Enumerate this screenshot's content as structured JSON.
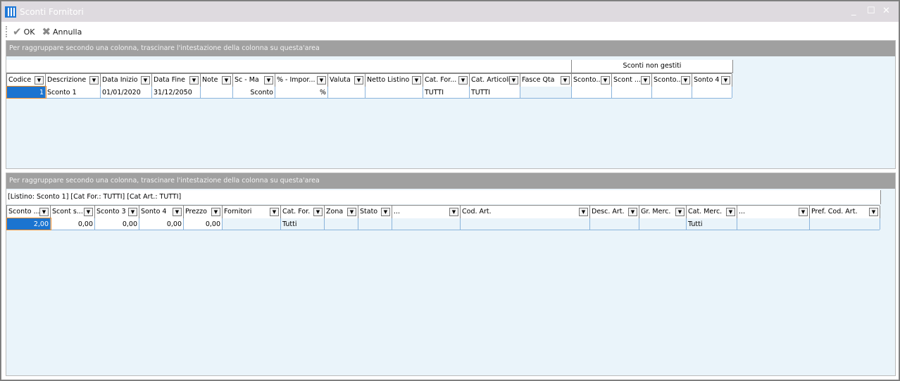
{
  "window": {
    "title": "Sconti Fornitori",
    "minimize": "_",
    "maximize": "☐",
    "close": "✕"
  },
  "toolbar": {
    "ok_label": "OK",
    "cancel_label": "Annulla"
  },
  "top_grid": {
    "group_hint": "Per raggruppare secondo una colonna, trascinare l'intestazione della colonna su questa'area",
    "band_label": "Sconti non gestiti",
    "columns": [
      "Codice",
      "Descrizione",
      "Data Inizio",
      "Data Fine",
      "Note",
      "Sc - Ma",
      "% - Impor...",
      "Valuta",
      "Netto Listino",
      "Cat. For...",
      "Cat. Articoli",
      "Fasce Qta",
      "Sconto...",
      "Scont ...",
      "Sconto...",
      "Sonto 4"
    ],
    "rows": [
      [
        "1",
        "Sconto 1",
        "01/01/2020",
        "31/12/2050",
        "",
        "Sconto",
        "%",
        "",
        "",
        "TUTTI",
        "TUTTI",
        "",
        "",
        "",
        "",
        ""
      ]
    ]
  },
  "bottom_grid": {
    "group_hint": "Per raggruppare secondo una colonna, trascinare l'intestazione della colonna su questa'area",
    "filter_text": "[Listino: Sconto 1]  [Cat For.: TUTTI]  [Cat Art.: TUTTI]",
    "columns": [
      "Sconto ...",
      "Scont s...",
      "Sconto 3",
      "Sonto 4",
      "Prezzo",
      "Fornitori",
      "Cat. For.",
      "Zona",
      "Stato",
      "...",
      "Cod. Art.",
      "Desc. Art.",
      "Gr. Merc.",
      "Cat. Merc.",
      "...",
      "Pref. Cod. Art."
    ],
    "rows": [
      [
        "2,00",
        "0,00",
        "0,00",
        "0,00",
        "0,00",
        "",
        "Tutti",
        "",
        "",
        "",
        "",
        "",
        "",
        "Tutti",
        "",
        ""
      ]
    ]
  }
}
